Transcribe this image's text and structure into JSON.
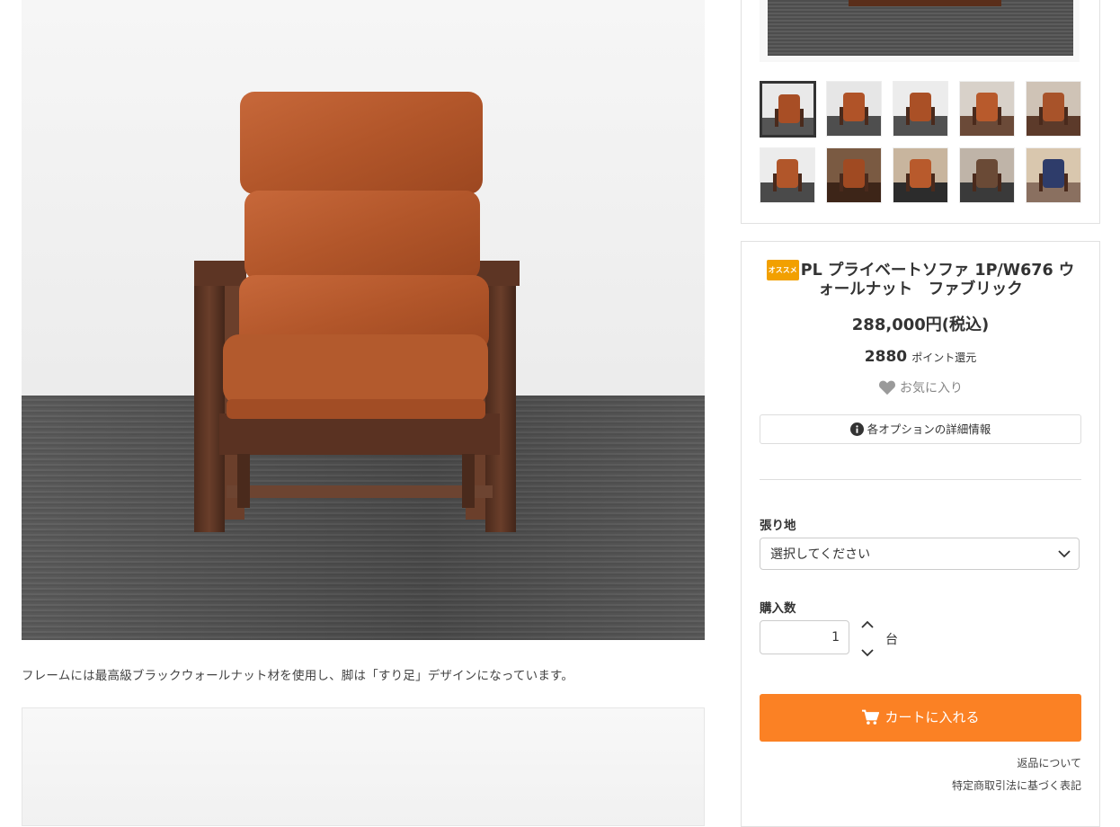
{
  "main_image": {
    "description_text": "フレームには最高級ブラックウォールナット材を使用し、脚は「すり足」デザインになっています。"
  },
  "gallery": {
    "thumbnails": [
      {
        "name": "thumb-1",
        "active": true
      },
      {
        "name": "thumb-2",
        "active": false
      },
      {
        "name": "thumb-3",
        "active": false
      },
      {
        "name": "thumb-4",
        "active": false
      },
      {
        "name": "thumb-5",
        "active": false
      },
      {
        "name": "thumb-6",
        "active": false
      },
      {
        "name": "thumb-7",
        "active": false
      },
      {
        "name": "thumb-8",
        "active": false
      },
      {
        "name": "thumb-9",
        "active": false
      },
      {
        "name": "thumb-10",
        "active": false
      }
    ]
  },
  "product": {
    "badge": "オススメ",
    "title": "PL プライベートソファ 1P/W676 ウォールナット　ファブリック",
    "price": "288,000円(税込)",
    "points_value": "2880",
    "points_label": "ポイント還元",
    "favorite_label": "お気に入り",
    "option_info_label": "各オプションの詳細情報",
    "upholstery_label": "張り地",
    "upholstery_placeholder": "選択してください",
    "quantity_label": "購入数",
    "quantity_value": "1",
    "quantity_unit": "台",
    "cart_button_label": "カートに入れる",
    "returns_link": "返品について",
    "legal_link": "特定商取引法に基づく表記"
  },
  "colors": {
    "accent": "#fb8124",
    "badge": "#f2a000",
    "wood": "#5a3424",
    "fabric": "#b95a2c"
  },
  "icons": {
    "favorite": "heart-icon",
    "info": "info-icon",
    "select": "chevron-down-icon",
    "cart": "cart-icon",
    "increment": "chevron-up-icon",
    "decrement": "chevron-down-icon"
  }
}
